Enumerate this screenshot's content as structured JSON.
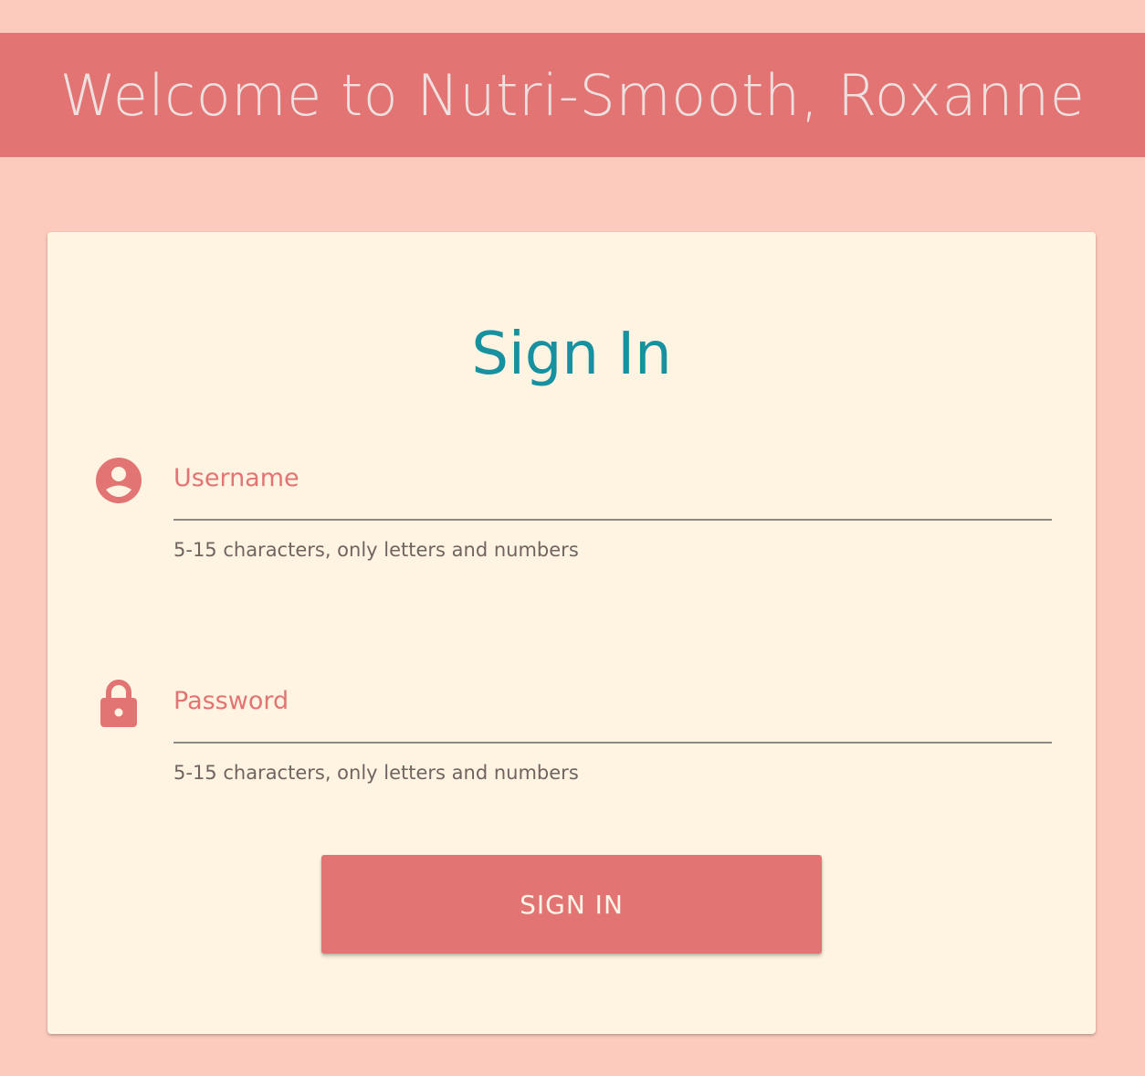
{
  "header": {
    "title": "Welcome to Nutri-Smooth, Roxanne"
  },
  "card": {
    "title": "Sign In",
    "username": {
      "icon": "account-circle-icon",
      "placeholder": "Username",
      "value": "",
      "hint": "5-15 characters, only letters and numbers"
    },
    "password": {
      "icon": "lock-icon",
      "placeholder": "Password",
      "value": "",
      "hint": "5-15 characters, only letters and numbers"
    },
    "submit_label": "SIGN IN"
  },
  "colors": {
    "background": "#fdcbbd",
    "header": "#e27474",
    "card": "#fff4e2",
    "title": "#17919f",
    "accent": "#e27474"
  }
}
